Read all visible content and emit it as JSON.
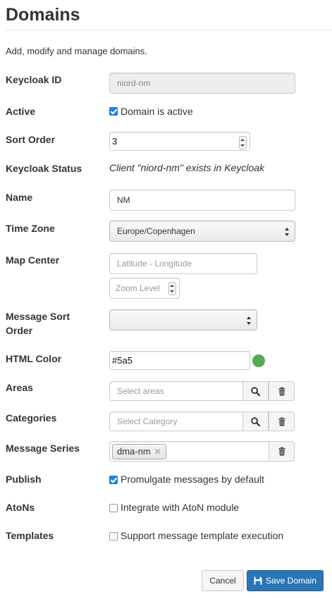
{
  "page": {
    "title": "Domains",
    "intro": "Add, modify and manage domains."
  },
  "form": {
    "keycloak_id": {
      "label": "Keycloak ID",
      "value": "niord-nm"
    },
    "active": {
      "label": "Active",
      "checkbox_label": "Domain is active",
      "checked": true
    },
    "sort_order": {
      "label": "Sort Order",
      "value": "3"
    },
    "keycloak_status": {
      "label": "Keycloak Status",
      "text": "Client \"niord-nm\" exists in Keycloak"
    },
    "name": {
      "label": "Name",
      "value": "NM"
    },
    "time_zone": {
      "label": "Time Zone",
      "value": "Europe/Copenhagen"
    },
    "map_center": {
      "label": "Map Center",
      "latlon_placeholder": "Latitude - Longitude",
      "zoom_placeholder": "Zoom Level"
    },
    "message_sort_order": {
      "label_line1": "Message Sort",
      "label_line2": "Order",
      "value": ""
    },
    "html_color": {
      "label": "HTML Color",
      "value": "#5a5",
      "swatch_color": "#55aa55"
    },
    "areas": {
      "label": "Areas",
      "placeholder": "Select areas"
    },
    "categories": {
      "label": "Categories",
      "placeholder": "Select Category"
    },
    "message_series": {
      "label": "Message Series",
      "tags": [
        "dma-nm"
      ]
    },
    "publish": {
      "label": "Publish",
      "checkbox_label": "Promulgate messages by default",
      "checked": true
    },
    "atons": {
      "label": "AtoNs",
      "checkbox_label": "Integrate with AtoN module",
      "checked": false
    },
    "templates": {
      "label": "Templates",
      "checkbox_label": "Support message template execution",
      "checked": false
    }
  },
  "actions": {
    "cancel_label": "Cancel",
    "save_label": "Save Domain"
  },
  "colors": {
    "primary": "#2a75b6",
    "checkbox": "#1e88e5",
    "swatch": "#55aa55"
  },
  "icons": [
    "search-icon",
    "trash-icon",
    "floppy-disk-icon",
    "close-icon",
    "spinner-arrows-icon",
    "select-arrows-icon",
    "checkbox-icon"
  ]
}
